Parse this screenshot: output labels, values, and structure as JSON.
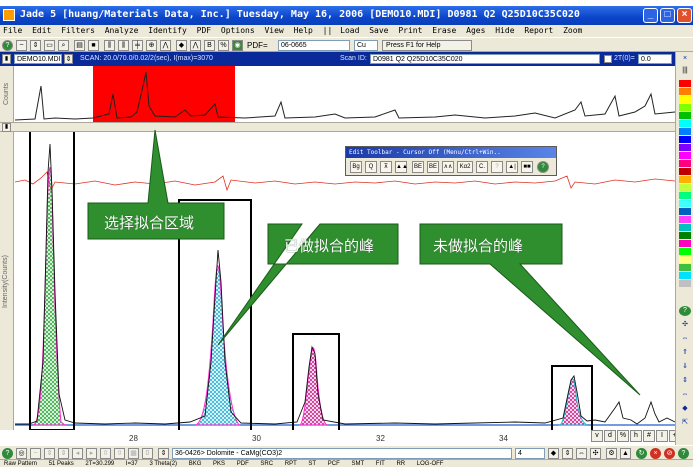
{
  "header_strip": {
    "text": ""
  },
  "window": {
    "title": "Jade 5 [huang/Materials Data, Inc.] Tuesday, May 16, 2006 [DEMO10.MDI] D0981 Q2 Q25D10C35C020",
    "buttons": [
      "_",
      "□",
      "×"
    ]
  },
  "menu": {
    "items": [
      "File",
      "Edit",
      "Filters",
      "Analyze",
      "Identify",
      "PDF",
      "Options",
      "View",
      "Help"
    ],
    "separator": "||",
    "items2": [
      "Load",
      "Save",
      "Print",
      "Erase",
      "Ages",
      "Hide",
      "Report",
      "Zoom"
    ]
  },
  "toolbar": {
    "pdf_label": "PDF=",
    "pdf_value": "06-0665",
    "element_value": "Cu",
    "help_label": "Press F1 for Help"
  },
  "scanbar": {
    "file": "DEMO10.MDI",
    "scan_text": "SCAN: 20.0/70.0/0.02/2(sec), I(max)=3070",
    "scan_id_label": "Scan ID:",
    "scan_id": "D0981 Q2 Q25D10C35C020",
    "theta_label": "2T(0)=",
    "theta_value": "0.0"
  },
  "overview": {
    "ylabel": "Counts"
  },
  "main": {
    "ylabel": "Intensity(Counts)"
  },
  "edit_toolbar": {
    "title": "Edit Toolbar - Cursor Off (Menu/Ctrl+Win..",
    "buttons": [
      "Bg",
      "Q",
      "⊼",
      "▲▲",
      "BE",
      "BE",
      "∧∧",
      "Kα2",
      "C.",
      "?",
      "▲|",
      "■■",
      "?"
    ]
  },
  "annotations": {
    "select_region": "选择拟合区域",
    "fitted_peak": "已做拟合的峰",
    "unfitted_peak": "未做拟合的峰"
  },
  "xaxis": {
    "ticks": [
      28,
      30,
      32,
      34
    ]
  },
  "xaxis_buttons": [
    "v",
    "d",
    "%",
    "h",
    "#",
    "I",
    "+",
    "x"
  ],
  "bottombar": {
    "phase": "36-0426> Dolomite - CaMg(CO3)2",
    "count": "4",
    "mode": "LOG-OFF"
  },
  "statusbar": {
    "items": [
      "Raw Pattern",
      "51 Peaks",
      "2T=30.299",
      "I=37",
      "3 Theta(2)",
      "BKG",
      "PKS",
      "PDF",
      "SRC",
      "RPT",
      "ST",
      "PCF",
      "SMT",
      "FIT",
      "RR"
    ]
  },
  "colors": {
    "title_blue": "#0b45c9",
    "scan_blue": "#0a2a9a",
    "select_red": "#ff0000",
    "callout_green": "#2f8f2f",
    "fit_peak_green": "#2faa3c",
    "fit_peak_cyan": "#27b0d6",
    "fit_peak_pink": "#d0238c",
    "fit_curve_magenta": "#ff2bd4",
    "diff_curve_red": "#e03020"
  }
}
